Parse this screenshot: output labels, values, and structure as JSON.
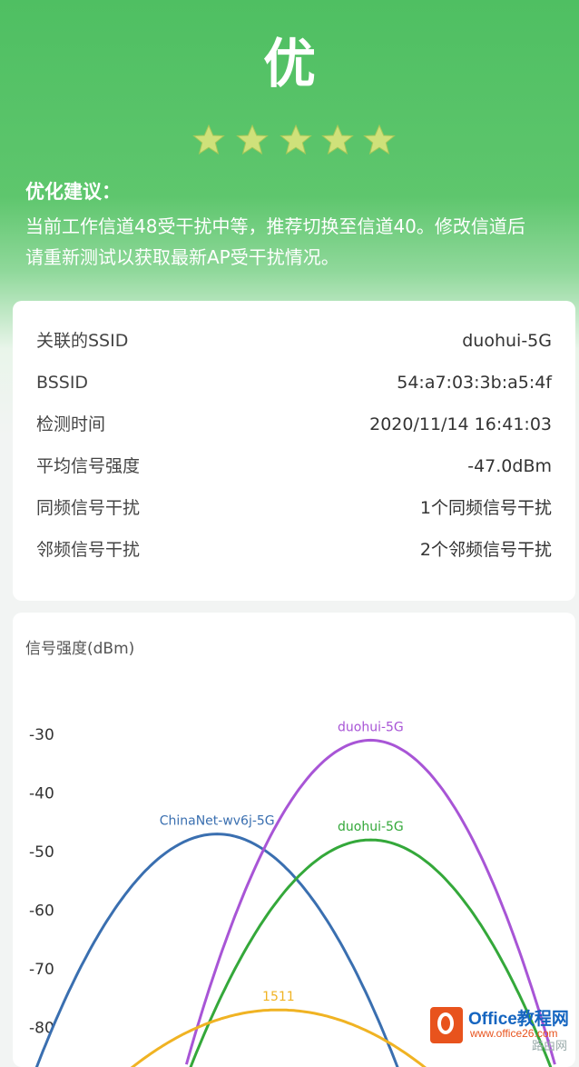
{
  "header": {
    "grade": "优",
    "rating": 5,
    "rating_max": 5,
    "advice_title": "优化建议：",
    "advice_line1": "当前工作信道48受干扰中等，推荐切换至信道40。修改信道后",
    "advice_line2": "请重新测试以获取最新AP受干扰情况。"
  },
  "info": {
    "rows": [
      {
        "label": "关联的SSID",
        "value": "duohui-5G"
      },
      {
        "label": "BSSID",
        "value": "54:a7:03:3b:a5:4f"
      },
      {
        "label": "检测时间",
        "value": "2020/11/14 16:41:03"
      },
      {
        "label": "平均信号强度",
        "value": "-47.0dBm"
      },
      {
        "label": "同频信号干扰",
        "value": "1个同频信号干扰"
      },
      {
        "label": "邻频信号干扰",
        "value": "2个邻频信号干扰"
      }
    ]
  },
  "chart": {
    "title": "信号强度(dBm)"
  },
  "chart_data": {
    "type": "line",
    "ylabel": "信号强度(dBm)",
    "yticks": [
      -30,
      -40,
      -50,
      -60,
      -70,
      -80
    ],
    "ylim": [
      -85,
      -25
    ],
    "series": [
      {
        "name": "ChinaNet-wv6j-5G",
        "color": "#3a6fb0",
        "peak": -47,
        "center": 30,
        "halfwidth": 30
      },
      {
        "name": "duohui-5G",
        "color": "#a855d6",
        "peak": -31,
        "center": 60,
        "halfwidth": 30
      },
      {
        "name": "duohui-5G",
        "color": "#34a83a",
        "peak": -48,
        "center": 60,
        "halfwidth": 30
      },
      {
        "name": "1511",
        "color": "#f0b323",
        "peak": -77,
        "center": 42,
        "halfwidth": 30
      }
    ]
  },
  "watermark": {
    "brand": "Office教程网",
    "url": "www.office26.com",
    "extra": "路由网"
  }
}
